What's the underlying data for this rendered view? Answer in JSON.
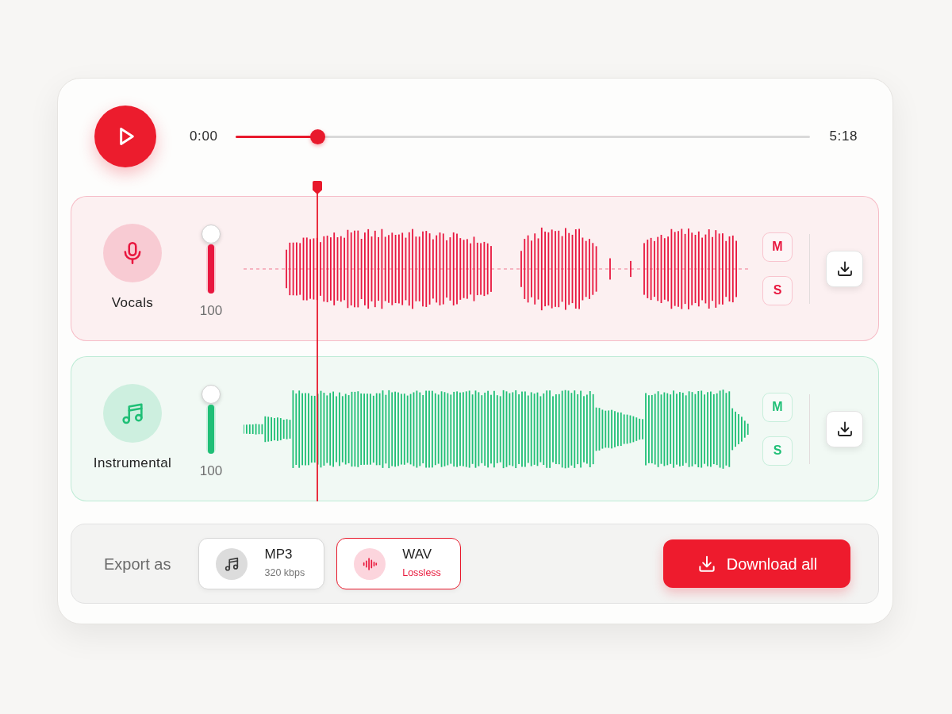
{
  "player": {
    "playing": false,
    "current_time": "0:00",
    "duration": "5:18",
    "level": 0.143
  },
  "tracks": [
    {
      "name": "Vocals",
      "color": "#e8173f",
      "volume": {
        "level": 1,
        "reading": "100"
      },
      "mute": {
        "label": "M",
        "on": false
      },
      "solo": {
        "label": "S",
        "on": false
      }
    },
    {
      "name": "Instrumental",
      "color": "#1fbf76",
      "volume": {
        "level": 1,
        "reading": "100"
      },
      "mute": {
        "label": "M",
        "on": false
      },
      "solo": {
        "label": "S",
        "on": false
      }
    }
  ],
  "export": {
    "label": "Export as",
    "formats": [
      {
        "name": "MP3",
        "detail": "320 kbps",
        "selected": false
      },
      {
        "name": "WAV",
        "detail": "Lossless",
        "selected": true
      }
    ],
    "download_all": "Download all"
  }
}
